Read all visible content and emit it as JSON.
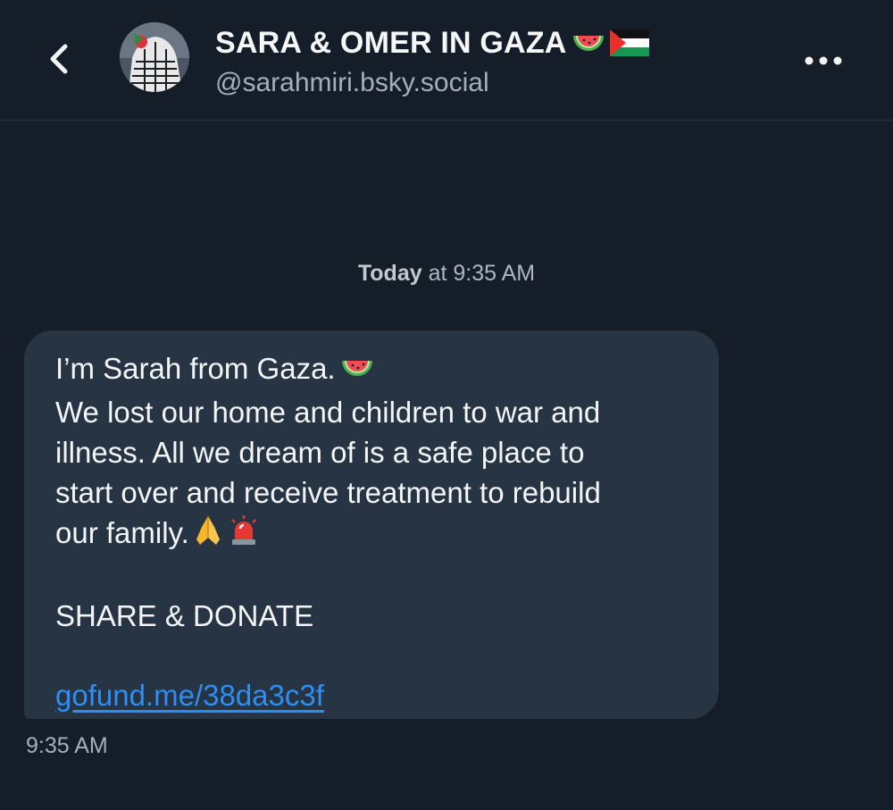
{
  "header": {
    "back_icon": "chevron-left-icon",
    "title": "SARA & OMER IN GAZA",
    "title_emojis": [
      "watermelon-icon",
      "palestine-flag-icon"
    ],
    "handle": "@sarahmiri.bsky.social",
    "more_icon": "more-horizontal-icon"
  },
  "conversation": {
    "date_separator": {
      "day": "Today",
      "rest": "at 9:35 AM"
    },
    "message": {
      "line1": "I’m Sarah from Gaza.",
      "line2": "We lost our home and children to war and",
      "line3": "illness. All we dream of is a safe place to",
      "line4": "start over and receive treatment to rebuild",
      "line5": "our family.",
      "line7": "SHARE & DONATE",
      "link": "gofund.me/38da3c3f",
      "emojis": [
        "watermelon-icon",
        "folded-hands-icon",
        "siren-icon"
      ],
      "timestamp": "9:35 AM"
    }
  },
  "colors": {
    "background": "#151d28",
    "bubble": "#263443",
    "link": "#2f8ef4",
    "secondary_text": "#a5afbb"
  }
}
